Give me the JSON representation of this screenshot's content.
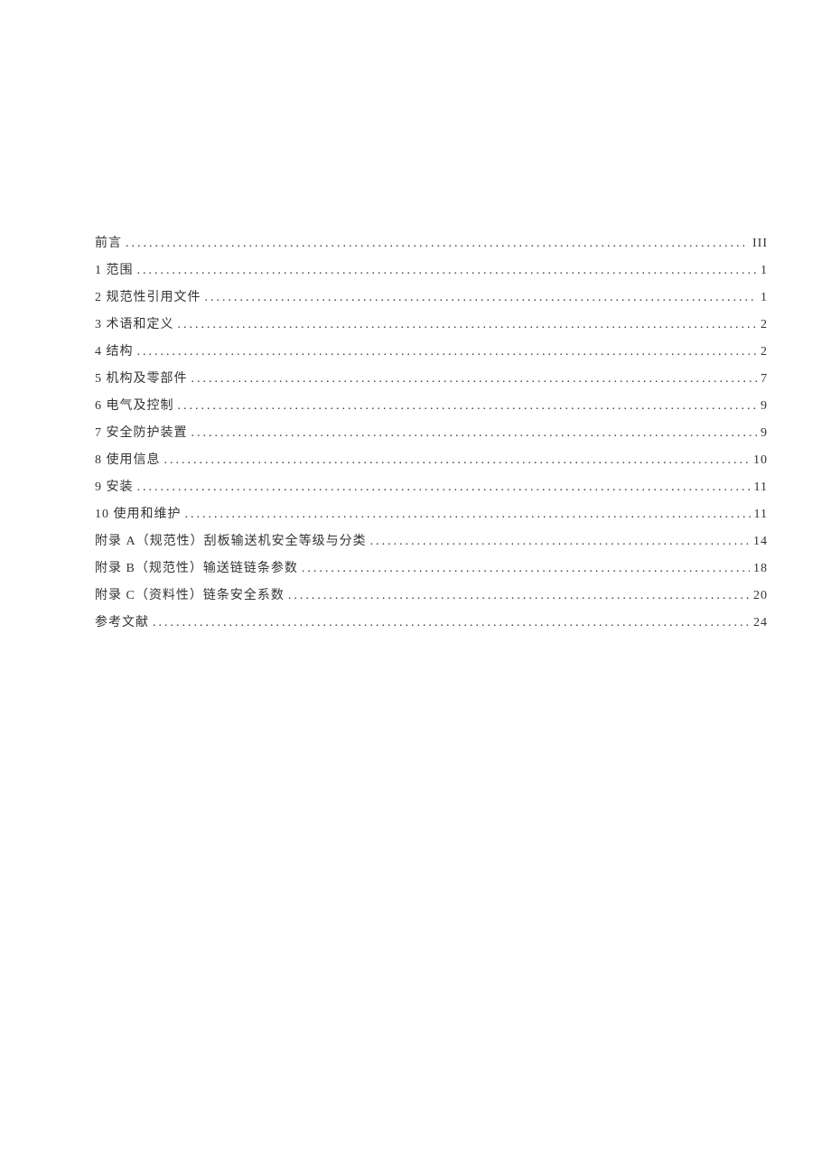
{
  "toc": [
    {
      "title": "前言",
      "page": "III"
    },
    {
      "title": "1 范围",
      "page": "1"
    },
    {
      "title": "2 规范性引用文件",
      "page": "1"
    },
    {
      "title": "3 术语和定义",
      "page": "2"
    },
    {
      "title": "4 结构",
      "page": "2"
    },
    {
      "title": "5 机构及零部件",
      "page": "7"
    },
    {
      "title": "6 电气及控制",
      "page": "9"
    },
    {
      "title": "7 安全防护装置",
      "page": "9"
    },
    {
      "title": "8 使用信息",
      "page": "10"
    },
    {
      "title": "9 安装",
      "page": "11"
    },
    {
      "title": "10 使用和维护",
      "page": "11"
    },
    {
      "title": "附录 A（规范性）刮板输送机安全等级与分类",
      "page": "14"
    },
    {
      "title": "附录 B（规范性）输送链链条参数",
      "page": "18"
    },
    {
      "title": "附录 C（资料性）链条安全系数",
      "page": "20"
    },
    {
      "title": "参考文献",
      "page": "24"
    }
  ]
}
